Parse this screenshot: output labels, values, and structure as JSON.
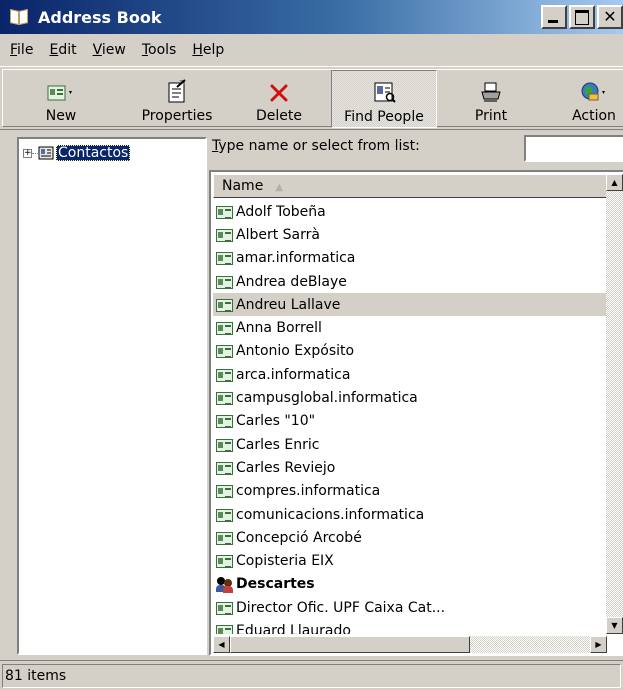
{
  "window": {
    "title": "Address Book"
  },
  "menu": [
    {
      "label": "File",
      "hotkey": "F",
      "rest": "ile"
    },
    {
      "label": "Edit",
      "hotkey": "E",
      "rest": "dit"
    },
    {
      "label": "View",
      "hotkey": "V",
      "rest": "iew"
    },
    {
      "label": "Tools",
      "hotkey": "T",
      "rest": "ools"
    },
    {
      "label": "Help",
      "hotkey": "H",
      "rest": "elp"
    }
  ],
  "toolbar": {
    "new": "New",
    "properties": "Properties",
    "delete": "Delete",
    "find_people": "Find People",
    "print": "Print",
    "action": "Action"
  },
  "tree": {
    "root": "Contactos"
  },
  "search": {
    "label_hotkey": "T",
    "label_rest": "ype name or select from list:",
    "value": ""
  },
  "list": {
    "column_name": "Name",
    "rows": [
      "Adolf Tobeña",
      "Albert Sarrà",
      "amar.informatica",
      "Andrea deBlaye",
      "Andreu Lallave",
      "Anna Borrell",
      "Antonio Expósito",
      "arca.informatica",
      "campusglobal.informatica",
      "Carles \"10\"",
      "Carles Enric",
      "Carles Reviejo",
      "compres.informatica",
      "comunicacions.informatica",
      "Concepció Arcobé",
      "Copisteria EIX",
      "Descartes",
      "Director Ofic. UPF Caixa Cat...",
      "Eduard Llaurado"
    ]
  },
  "status": {
    "text": "81 items"
  }
}
